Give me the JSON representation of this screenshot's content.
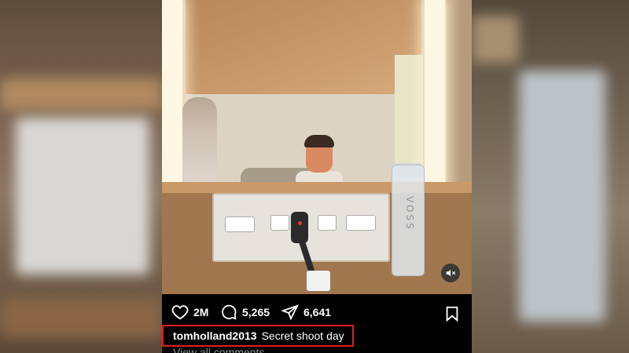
{
  "post": {
    "likes": "2M",
    "comments": "5,265",
    "shares": "6,641",
    "username": "tomholland2013",
    "caption": "Secret shoot day",
    "view_all_comments": "View all comments",
    "bottle_label": "VOSS"
  },
  "icons": {
    "like": "heart-icon",
    "comment": "comment-icon",
    "share": "send-icon",
    "save": "bookmark-icon",
    "mute": "muted-speaker-icon"
  },
  "colors": {
    "highlight_box": "#e21d1d",
    "background": "#000000"
  }
}
